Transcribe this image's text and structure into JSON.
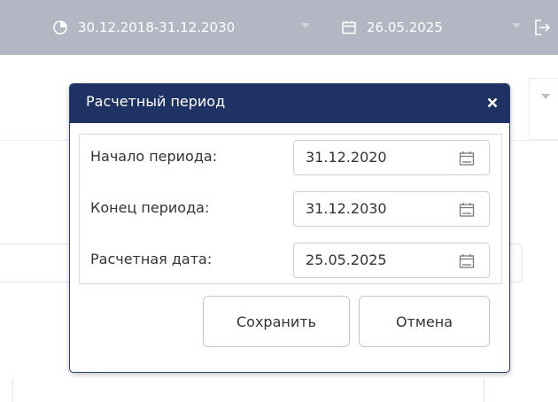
{
  "header": {
    "period_range": "30.12.2018-31.12.2030",
    "calc_date": "26.05.2025",
    "period_icon": "pie-clock-icon",
    "date_icon": "calendar-icon",
    "logout_icon": "logout-icon"
  },
  "modal": {
    "title": "Расчетный период",
    "close_icon": "close-icon",
    "fields": [
      {
        "label": "Начало периода:",
        "value": "31.12.2020",
        "icon": "calendar-icon"
      },
      {
        "label": "Конец периода:",
        "value": "31.12.2030",
        "icon": "calendar-icon"
      },
      {
        "label": "Расчетная дата:",
        "value": "25.05.2025",
        "icon": "calendar-icon"
      }
    ],
    "save_label": "Сохранить",
    "cancel_label": "Отмена"
  },
  "colors": {
    "topbar": "#b3b7c3",
    "modal_header": "#1e3264",
    "icon_gray": "#7a7a7a"
  }
}
